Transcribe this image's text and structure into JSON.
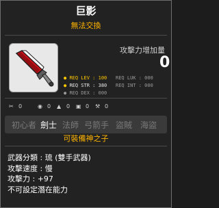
{
  "item": {
    "name": "巨影",
    "trade_status": "無法交換",
    "attack_increase_label": "攻擊力增加量",
    "attack_increase_value": "0"
  },
  "requirements": {
    "left": [
      {
        "label": "REQ LEV",
        "value": "100"
      },
      {
        "label": "REQ STR",
        "value": "380"
      },
      {
        "label": "REQ DEX",
        "value": "000"
      }
    ],
    "right": [
      {
        "label": "REQ LUK",
        "value": "000"
      },
      {
        "label": "REQ INT",
        "value": "000"
      }
    ]
  },
  "icons_row": [
    "0",
    "0",
    "0",
    "0",
    "0"
  ],
  "jobs": {
    "list": [
      "初心者",
      "劍士",
      "法師",
      "弓箭手",
      "盜賊",
      "海盜"
    ],
    "active": "劍士",
    "note": "可裝備神之子"
  },
  "stats": [
    "武器分類 : 琉 (雙手武器)",
    "攻擊速度 : 慢",
    "攻擊力 : +97",
    "不可設定潛在能力"
  ],
  "colors": {
    "accent": "#ffb400",
    "background": "#222222",
    "blade": "#d21a1a"
  }
}
